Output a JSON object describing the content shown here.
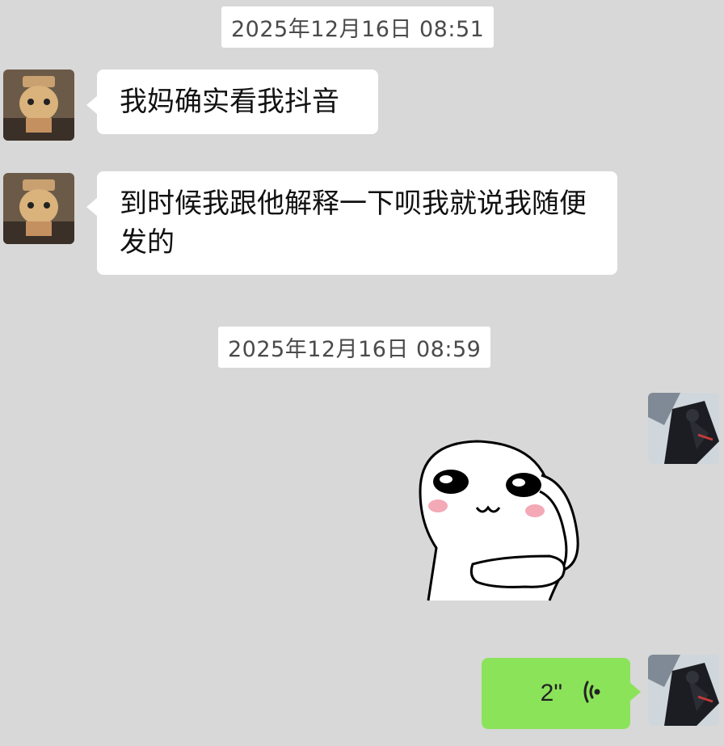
{
  "chat": {
    "messages": [
      {
        "type": "timestamp",
        "text": "2025年12月16日 08:51"
      },
      {
        "type": "text",
        "side": "left",
        "text": "我妈确实看我抖音"
      },
      {
        "type": "text",
        "side": "left",
        "text": "到时候我跟他解释一下呗我就说我随便发的"
      },
      {
        "type": "timestamp",
        "text": "2025年12月16日 08:59"
      },
      {
        "type": "sticker",
        "side": "right",
        "icon": "thinking-face-sticker"
      },
      {
        "type": "voice",
        "side": "right",
        "duration": "2\"",
        "icon": "voice-wave-icon"
      }
    ]
  },
  "colors": {
    "background": "#d8d8d8",
    "bubble_in": "#ffffff",
    "bubble_out": "#8be35a",
    "timestamp_bg": "#ffffff"
  }
}
